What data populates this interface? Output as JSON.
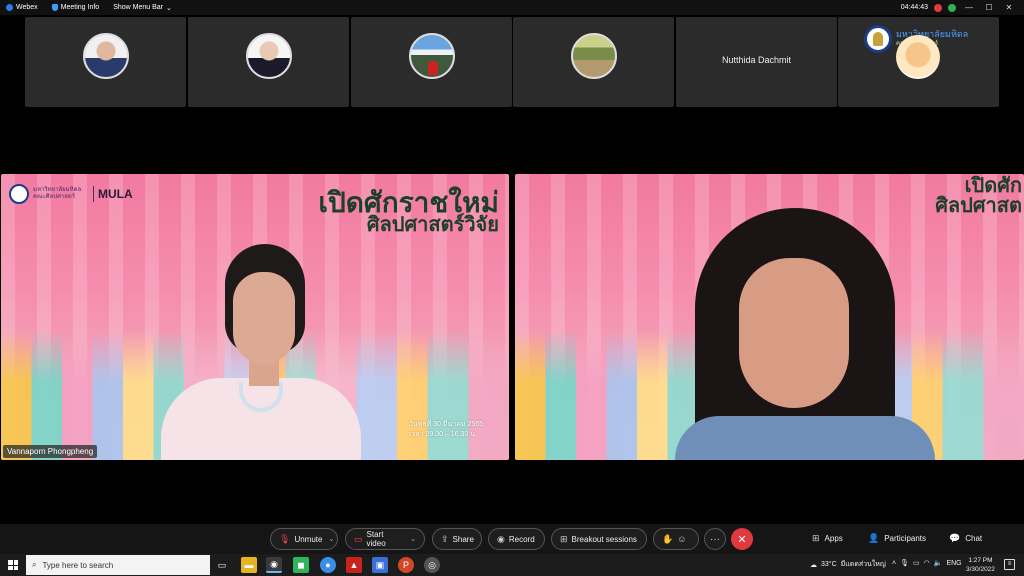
{
  "titlebar": {
    "app_name": "Webex",
    "meeting_info": "Meeting Info",
    "show_menu_bar": "Show Menu Bar",
    "time": "04:44:43"
  },
  "thumbnails": [
    {
      "type": "avatar"
    },
    {
      "type": "avatar"
    },
    {
      "type": "avatar"
    },
    {
      "type": "avatar"
    },
    {
      "type": "name",
      "name": "Nutthida Dachmit"
    },
    {
      "type": "logo",
      "text": "มหาวิทยาลัยมหิดล",
      "subtext": "คณะศิลปศาสตร์"
    }
  ],
  "video1": {
    "brand_text": "มหาวิทยาลัยมหิดล คณะศิลปศาสตร์",
    "brand_mark": "MULA",
    "headline_line1": "เปิดศักราชใหม่",
    "headline_line2": "ศิลปศาสตร์วิจัย",
    "date_line1": "วันพุธที่ 30 มีนาคม 2565",
    "date_line2": "เวลา 09.30 – 16.30 น.",
    "participant_name": "Vannaporn Phongpheng"
  },
  "video2": {
    "headline_line1": "เปิดศัก",
    "headline_line2": "ศิลปศาสต"
  },
  "controls": {
    "unmute": "Unmute",
    "start_video": "Start video",
    "share": "Share",
    "record": "Record",
    "breakout": "Breakout sessions",
    "more": "···",
    "apps": "Apps",
    "participants": "Participants",
    "chat": "Chat"
  },
  "taskbar": {
    "search_placeholder": "Type here to search",
    "weather": "33°C",
    "weather_desc": "มีแดดส่วนใหญ่",
    "language": "ENG",
    "clock_time": "1:27 PM",
    "clock_date": "3/30/2022"
  },
  "colors": {
    "leave_red": "#e0393e",
    "background": "#000000",
    "tile_bg": "#2b2b2b"
  }
}
